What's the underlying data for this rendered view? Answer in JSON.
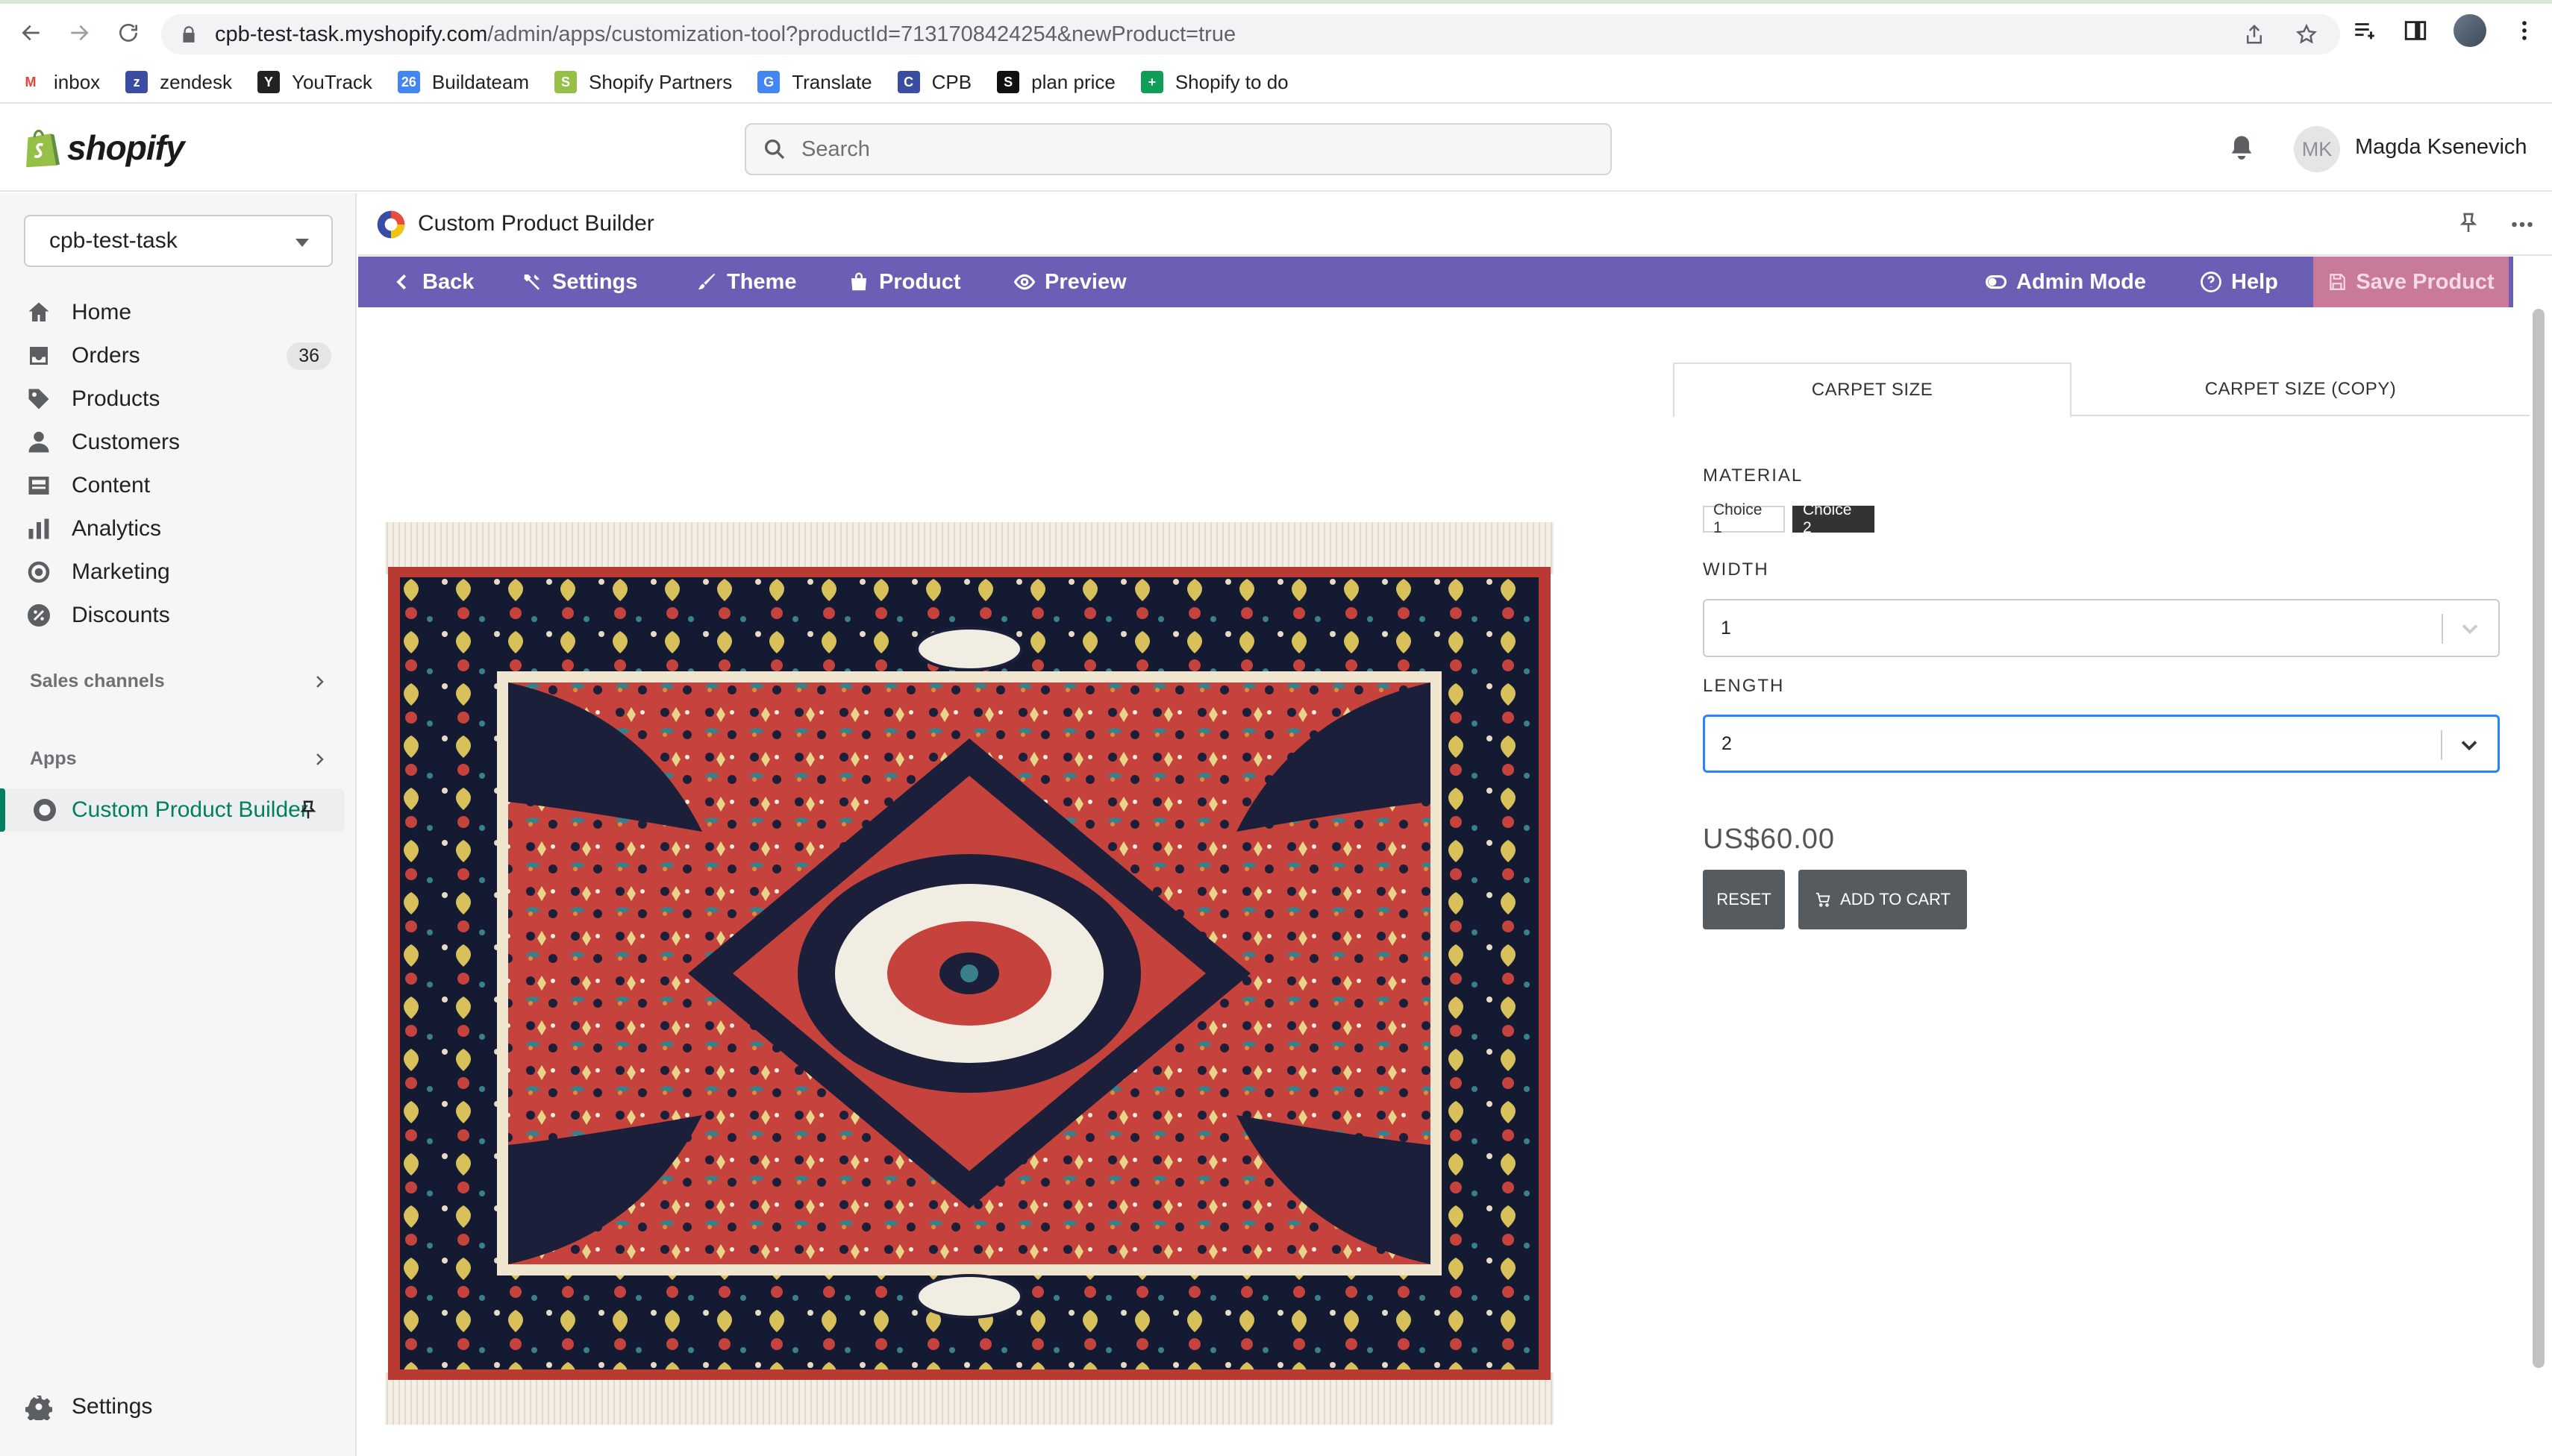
{
  "browser": {
    "url_host": "cpb-test-task.myshopify.com",
    "url_path": "/admin/apps/customization-tool?productId=7131708424254&newProduct=true",
    "bookmarks": [
      {
        "label": "inbox",
        "icon": "gmail-icon",
        "color": "#ea4335"
      },
      {
        "label": "zendesk",
        "icon": "zendesk-icon",
        "color": "#3b4da3"
      },
      {
        "label": "YouTrack",
        "icon": "youtrack-icon",
        "color": "#222222"
      },
      {
        "label": "Buildateam",
        "icon": "calendar-icon",
        "color": "#4285f4"
      },
      {
        "label": "Shopify Partners",
        "icon": "shopify-icon",
        "color": "#95bf47"
      },
      {
        "label": "Translate",
        "icon": "translate-icon",
        "color": "#4285f4"
      },
      {
        "label": "CPB",
        "icon": "cpb-icon",
        "color": "#3b4da3"
      },
      {
        "label": "plan price",
        "icon": "shopify-dark-icon",
        "color": "#111111"
      },
      {
        "label": "Shopify to do",
        "icon": "plus-icon",
        "color": "#0f9d58"
      }
    ]
  },
  "topbar": {
    "brand": "shopify",
    "search_placeholder": "Search",
    "user_initials": "MK",
    "user_name": "Magda Ksenevich"
  },
  "sidebar": {
    "store": "cpb-test-task",
    "items": [
      {
        "label": "Home",
        "icon": "home-icon"
      },
      {
        "label": "Orders",
        "icon": "orders-icon",
        "badge": "36"
      },
      {
        "label": "Products",
        "icon": "tag-icon"
      },
      {
        "label": "Customers",
        "icon": "person-icon"
      },
      {
        "label": "Content",
        "icon": "content-icon"
      },
      {
        "label": "Analytics",
        "icon": "analytics-icon"
      },
      {
        "label": "Marketing",
        "icon": "marketing-icon"
      },
      {
        "label": "Discounts",
        "icon": "discount-icon"
      }
    ],
    "sales_channels": "Sales channels",
    "apps": "Apps",
    "active_app": "Custom Product Builder",
    "settings": "Settings"
  },
  "app": {
    "title": "Custom Product Builder",
    "toolbar": {
      "back": "Back",
      "settings": "Settings",
      "theme": "Theme",
      "product": "Product",
      "preview": "Preview",
      "admin_mode": "Admin Mode",
      "help": "Help",
      "save": "Save Product"
    },
    "colors": {
      "toolbar": "#6b5fb5",
      "save": "#c9799a",
      "accent": "#008060"
    }
  },
  "builder": {
    "tabs": [
      "CARPET SIZE",
      "CARPET SIZE (COPY)"
    ],
    "active_tab": "CARPET SIZE",
    "material_label": "MATERIAL",
    "material_choices": [
      "Choice 1",
      "Choice 2"
    ],
    "material_selected": "Choice 2",
    "width_label": "WIDTH",
    "width_value": "1",
    "length_label": "LENGTH",
    "length_value": "2",
    "price": "US$60.00",
    "reset": "RESET",
    "add_to_cart": "ADD TO CART"
  }
}
